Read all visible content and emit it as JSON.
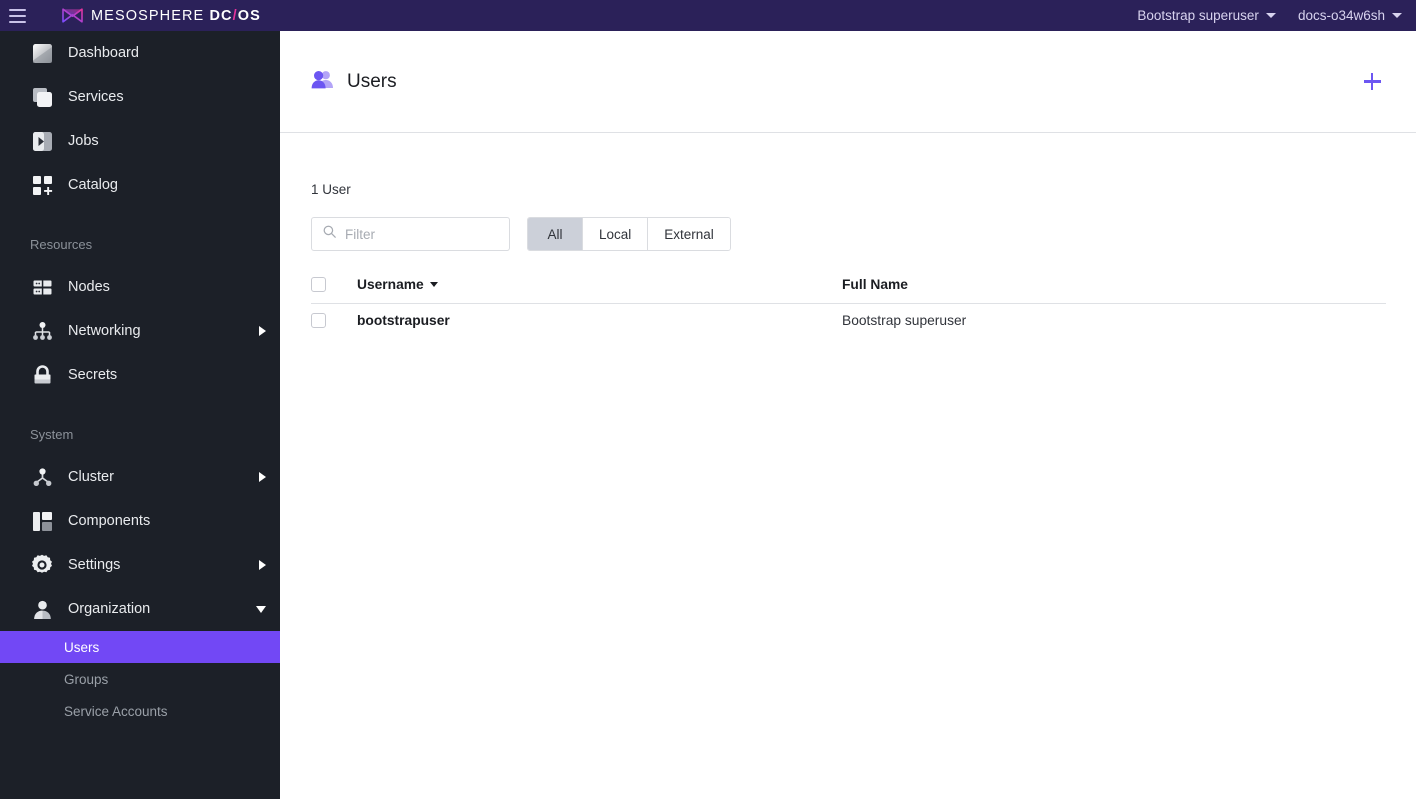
{
  "topbar": {
    "menu_icon": "hamburger-icon",
    "brand": {
      "logo_icon": "mesosphere-envelope-logo",
      "name": "MESOSPHERE",
      "product_prefix": "DC",
      "product_slash": "/",
      "product_suffix": "OS"
    },
    "user_menu": "Bootstrap superuser",
    "cluster_menu": "docs-o34w6sh"
  },
  "sidebar": {
    "primary_items": [
      {
        "label": "Dashboard",
        "icon": "dashboard-icon",
        "expandable": false,
        "expanded": false
      },
      {
        "label": "Services",
        "icon": "services-icon",
        "expandable": false,
        "expanded": false
      },
      {
        "label": "Jobs",
        "icon": "jobs-icon",
        "expandable": false,
        "expanded": false
      },
      {
        "label": "Catalog",
        "icon": "catalog-icon",
        "expandable": false,
        "expanded": false
      }
    ],
    "resources_section": "Resources",
    "resources_items": [
      {
        "label": "Nodes",
        "icon": "nodes-icon",
        "expandable": false,
        "expanded": false
      },
      {
        "label": "Networking",
        "icon": "networking-icon",
        "expandable": true,
        "expanded": false
      },
      {
        "label": "Secrets",
        "icon": "secrets-lock-icon",
        "expandable": false,
        "expanded": false
      }
    ],
    "system_section": "System",
    "system_items": [
      {
        "label": "Cluster",
        "icon": "cluster-icon",
        "expandable": true,
        "expanded": false
      },
      {
        "label": "Components",
        "icon": "components-icon",
        "expandable": false,
        "expanded": false
      },
      {
        "label": "Settings",
        "icon": "gear-icon",
        "expandable": true,
        "expanded": false
      },
      {
        "label": "Organization",
        "icon": "organization-person-icon",
        "expandable": true,
        "expanded": true
      }
    ],
    "organization_subitems": [
      {
        "label": "Users",
        "active": true
      },
      {
        "label": "Groups",
        "active": false
      },
      {
        "label": "Service Accounts",
        "active": false
      }
    ],
    "active_color": "#7248f5",
    "background_color": "#1c2028"
  },
  "main": {
    "page_title": "Users",
    "page_title_icon": "users-group-icon",
    "add_button_icon": "plus-icon",
    "count_label": "1 User",
    "filter": {
      "placeholder": "Filter",
      "value": "",
      "icon": "search-icon"
    },
    "segmented_control": {
      "options": [
        "All",
        "Local",
        "External"
      ],
      "selected": "All"
    },
    "table": {
      "columns": [
        "Username",
        "Full Name"
      ],
      "sort_column": "Username",
      "sort_direction": "descending",
      "rows": [
        {
          "username": "bootstrapuser",
          "full_name": "Bootstrap superuser",
          "selected": false
        }
      ]
    }
  },
  "theme": {
    "topbar_bg": "#2b2159",
    "accent_purple": "#6c56f2",
    "brand_pink": "#e5339b"
  }
}
